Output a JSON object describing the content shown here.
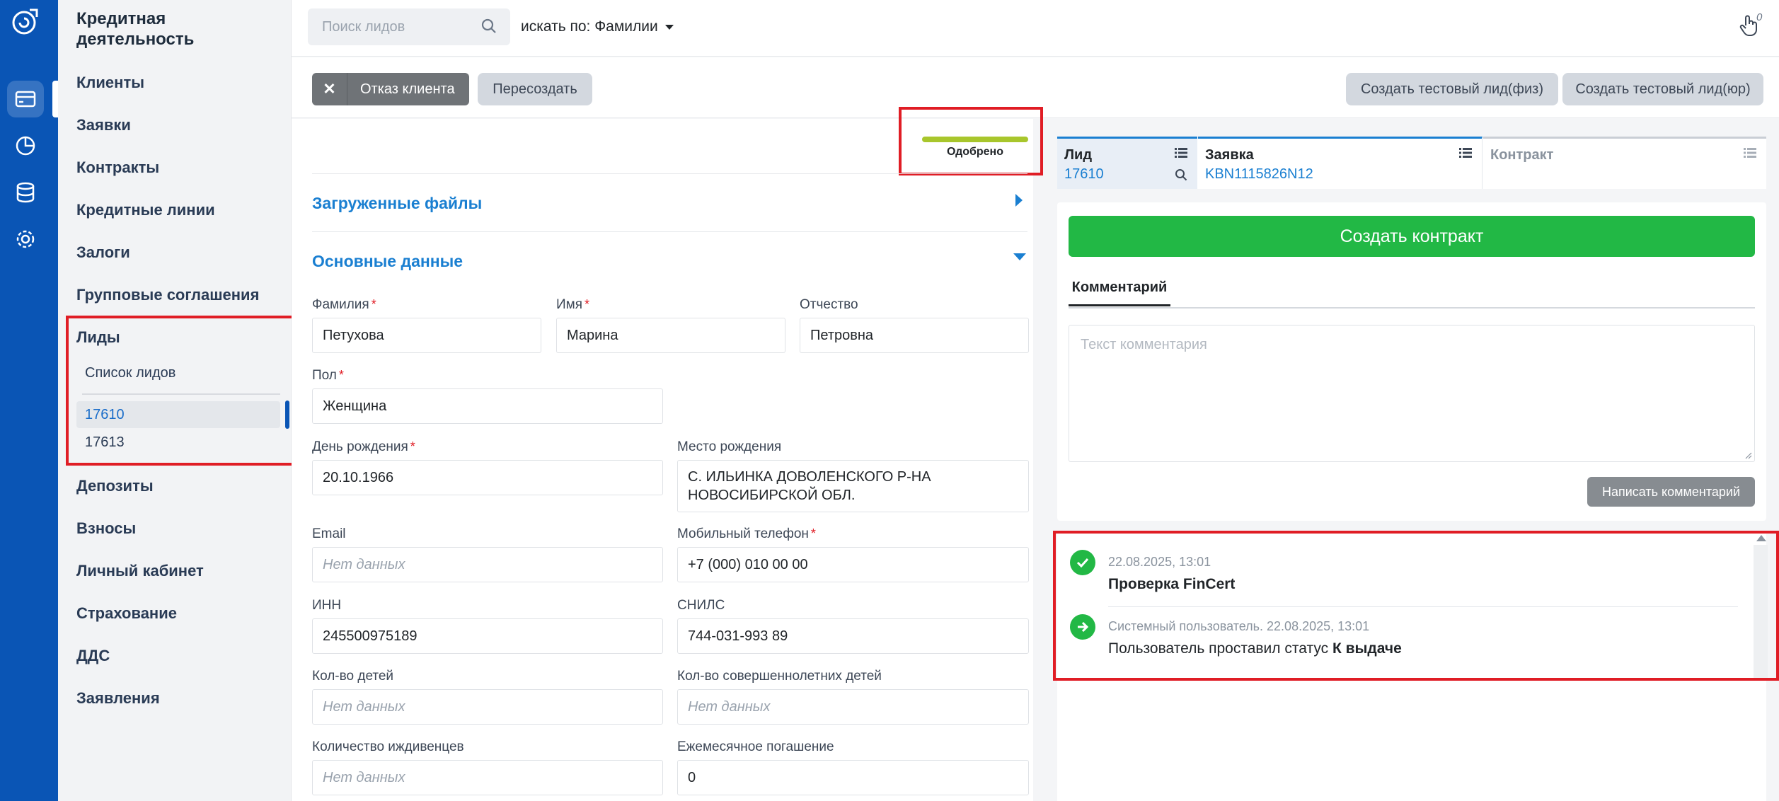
{
  "app": {
    "section_title": "Кредитная деятельность"
  },
  "colors": {
    "rail": "#0a55b5",
    "accent": "#1a7fd1",
    "success": "#22b845",
    "status_bar": "#a8c62c",
    "highlight": "#e01d25"
  },
  "rail_icons": [
    "card-icon",
    "pie-chart-icon",
    "database-icon",
    "settings-icon"
  ],
  "nav": {
    "items": [
      "Клиенты",
      "Заявки",
      "Контракты",
      "Кредитные линии",
      "Залоги",
      "Групповые соглашения",
      "Лиды",
      "Депозиты",
      "Взносы",
      "Личный кабинет",
      "Страхование",
      "ДДС",
      "Заявления"
    ],
    "leads_sub": "Список лидов",
    "lead_ids": [
      "17610",
      "17613"
    ]
  },
  "topbar": {
    "search_placeholder": "Поиск лидов",
    "search_by": "искать по: Фамилии",
    "notif_count": "0"
  },
  "actions": {
    "reject": "Отказ клиента",
    "recreate": "Пересоздать",
    "test_phys": "Создать тестовый лид(физ)",
    "test_jur": "Создать тестовый лид(юр)"
  },
  "status": {
    "label": "Одобрено"
  },
  "sections": {
    "files": "Загруженные файлы",
    "main": "Основные данные"
  },
  "form": {
    "surname_label": "Фамилия",
    "surname": "Петухова",
    "name_label": "Имя",
    "name": "Марина",
    "patronymic_label": "Отчество",
    "patronymic": "Петровна",
    "gender_label": "Пол",
    "gender": "Женщина",
    "birthday_label": "День рождения",
    "birthday": "20.10.1966",
    "birthplace_label": "Место рождения",
    "birthplace": "С. ИЛЬИНКА ДОВОЛЕНСКОГО Р-НА НОВОСИБИРСКОЙ ОБЛ.",
    "email_label": "Email",
    "empty": "Нет данных",
    "phone_label": "Мобильный телефон",
    "phone": "+7 (000) 010 00 00",
    "inn_label": "ИНН",
    "inn": "245500975189",
    "snils_label": "СНИЛС",
    "snils": "744-031-993 89",
    "children_label": "Кол-во детей",
    "adult_children_label": "Кол-во совершеннолетних детей",
    "dependents_label": "Количество иждивенцев",
    "monthly_label": "Ежемесячное погашение",
    "monthly": "0"
  },
  "tabs": {
    "lead_title": "Лид",
    "lead_value": "17610",
    "app_title": "Заявка",
    "app_value": "KBN1115826N12",
    "contract_title": "Контракт"
  },
  "right": {
    "create_contract": "Создать контракт",
    "comment_tab": "Комментарий",
    "comment_placeholder": "Текст комментария",
    "write_comment": "Написать комментарий"
  },
  "events": [
    {
      "meta": "22.08.2025, 13:01",
      "text": "Проверка FinCert"
    },
    {
      "meta": "Системный пользователь. 22.08.2025, 13:01",
      "text": "Пользователь проставил статус ",
      "strong": "К выдаче"
    }
  ]
}
